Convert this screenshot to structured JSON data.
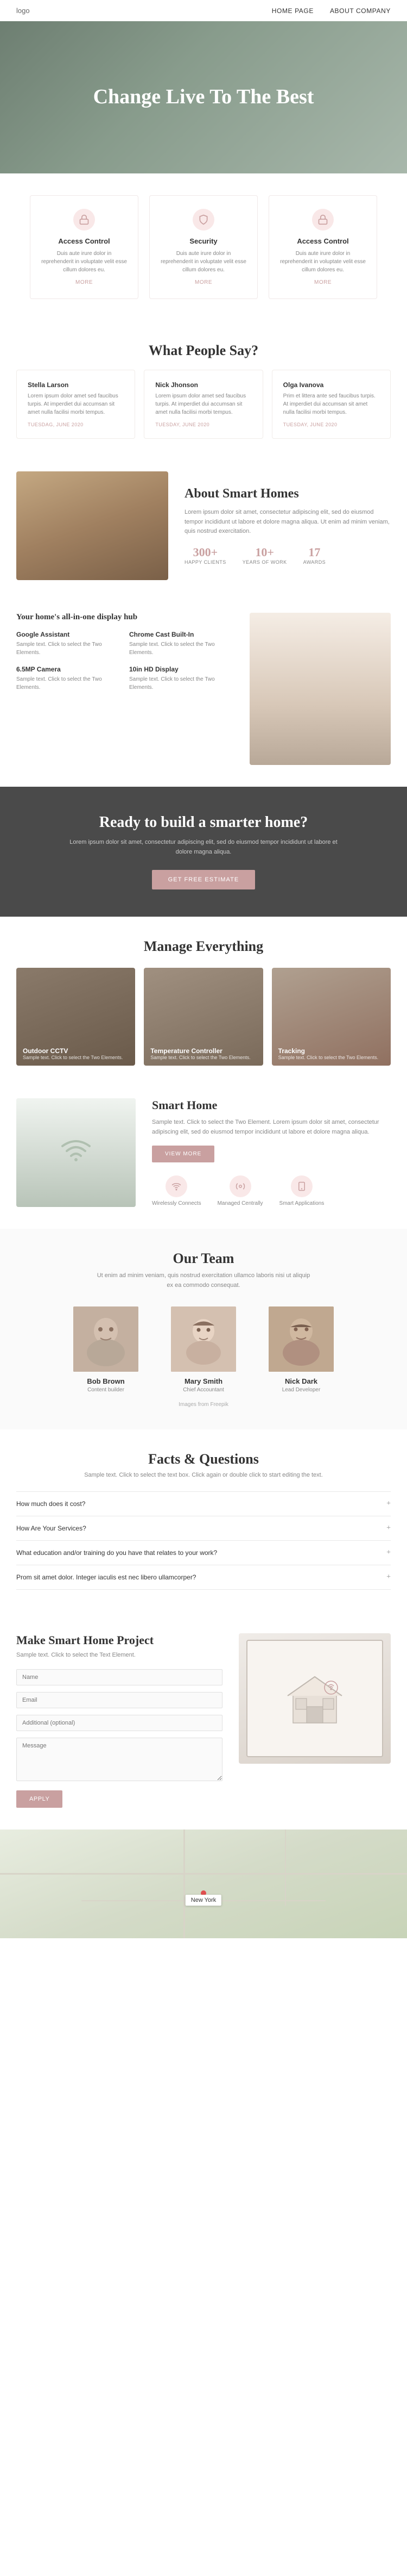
{
  "nav": {
    "logo": "logo",
    "links": [
      "HOME PAGE",
      "ABOUT COMPANY"
    ]
  },
  "hero": {
    "title": "Change Live To The Best"
  },
  "features": [
    {
      "title": "Access Control",
      "description": "Duis aute irure dolor in reprehenderit in voluptate velit esse cillum dolores eu.",
      "more": "MORE"
    },
    {
      "title": "Security",
      "description": "Duis aute irure dolor in reprehenderit in voluptate velit esse cillum dolores eu.",
      "more": "MORE"
    },
    {
      "title": "Access Control",
      "description": "Duis aute irure dolor in reprehenderit in voluptate velit esse cillum dolores eu.",
      "more": "MORE"
    }
  ],
  "testimonials": {
    "section_title": "What People Say?",
    "items": [
      {
        "name": "Stella Larson",
        "text": "Lorem ipsum dolor amet sed faucibus turpis. At imperdiet dui accumsan sit amet nulla facilisi morbi tempus.",
        "date": "TUESDAG, JUNE 2020"
      },
      {
        "name": "Nick Jhonson",
        "text": "Lorem ipsum dolor amet sed faucibus turpis. At imperdiet dui accumsan sit amet nulla facilisi morbi tempus.",
        "date": "TUESDAY, JUNE 2020"
      },
      {
        "name": "Olga Ivanova",
        "text": "Prim et littera ante sed faucibus turpis. At imperdiet dui accumsan sit amet nulla facilisi morbi tempus.",
        "date": "TUESDAY, JUNE 2020"
      }
    ]
  },
  "about": {
    "title": "About Smart Homes",
    "description": "Lorem ipsum dolor sit amet, consectetur adipiscing elit, sed do eiusmod tempor incididunt ut labore et dolore magna aliqua. Ut enim ad minim veniam, quis nostrud exercitation.",
    "stats": [
      {
        "number": "300+",
        "label": "HAPPY CLIENTS"
      },
      {
        "number": "10+",
        "label": "YEARS OF WORK"
      },
      {
        "number": "17",
        "label": "AWARDS"
      }
    ]
  },
  "hub": {
    "title": "Your home's all-in-one display hub",
    "items": [
      {
        "title": "Google Assistant",
        "description": "Sample text. Click to select the Two Elements."
      },
      {
        "title": "Chrome Cast Built-In",
        "description": "Sample text. Click to select the Two Elements."
      },
      {
        "title": "6.5MP Camera",
        "description": "Sample text. Click to select the Two Elements."
      },
      {
        "title": "10in HD Display",
        "description": "Sample text. Click to select the Two Elements."
      }
    ]
  },
  "cta": {
    "title": "Ready to build a smarter home?",
    "description": "Lorem ipsum dolor sit amet, consectetur adipiscing elit, sed do eiusmod tempor incididunt ut labore et dolore magna aliqua.",
    "button": "GET FREE ESTIMATE"
  },
  "manage": {
    "section_title": "Manage Everything",
    "cards": [
      {
        "title": "Outdoor CCTV",
        "description": "Sample text. Click to select the Two Elements."
      },
      {
        "title": "Temperature Controller",
        "description": "Sample text. Click to select the Two Elements."
      },
      {
        "title": "Tracking",
        "description": "Sample text. Click to select the Two Elements."
      }
    ]
  },
  "smart_home": {
    "title": "Smart Home",
    "description": "Sample text. Click to select the Two Element. Lorem ipsum dolor sit amet, consectetur adipiscing elit, sed do eiusmod tempor incididunt ut labore et dolore magna aliqua.",
    "button": "VIEW MORE",
    "icons": [
      {
        "label": "Wirelessly Connects"
      },
      {
        "label": "Managed Centrally"
      },
      {
        "label": "Smart Applications"
      }
    ]
  },
  "team": {
    "section_title": "Our Team",
    "subtitle": "Ut enim ad minim veniam, quis nostrud exercitation ullamco laboris nisi ut aliquip ex ea commodo consequat.",
    "members": [
      {
        "name": "Bob Brown",
        "role": "Content builder"
      },
      {
        "name": "Mary Smith",
        "role": "Chief Accountant"
      },
      {
        "name": "Nick Dark",
        "role": "Lead Developer"
      }
    ],
    "credit": "Images from Freepik"
  },
  "faq": {
    "section_title": "Facts & Questions",
    "subtitle": "Sample text. Click to select the text box. Click again or double click to start editing the text.",
    "items": [
      {
        "question": "How much does it cost?"
      },
      {
        "question": "How Are Your Services?"
      },
      {
        "question": "What education and/or training do you have that relates to your work?"
      },
      {
        "question": "Prom sit amet dolor. Integer iaculis est nec libero ullamcorper?"
      }
    ]
  },
  "contact": {
    "title": "Make Smart Home Project",
    "subtitle": "Sample text. Click to select the Text Element.",
    "form": {
      "name_placeholder": "Name",
      "email_placeholder": "Email",
      "phone_placeholder": "Additional (optional)",
      "message_placeholder": "Message",
      "submit": "APPLY"
    }
  },
  "map": {
    "label": "New York"
  }
}
